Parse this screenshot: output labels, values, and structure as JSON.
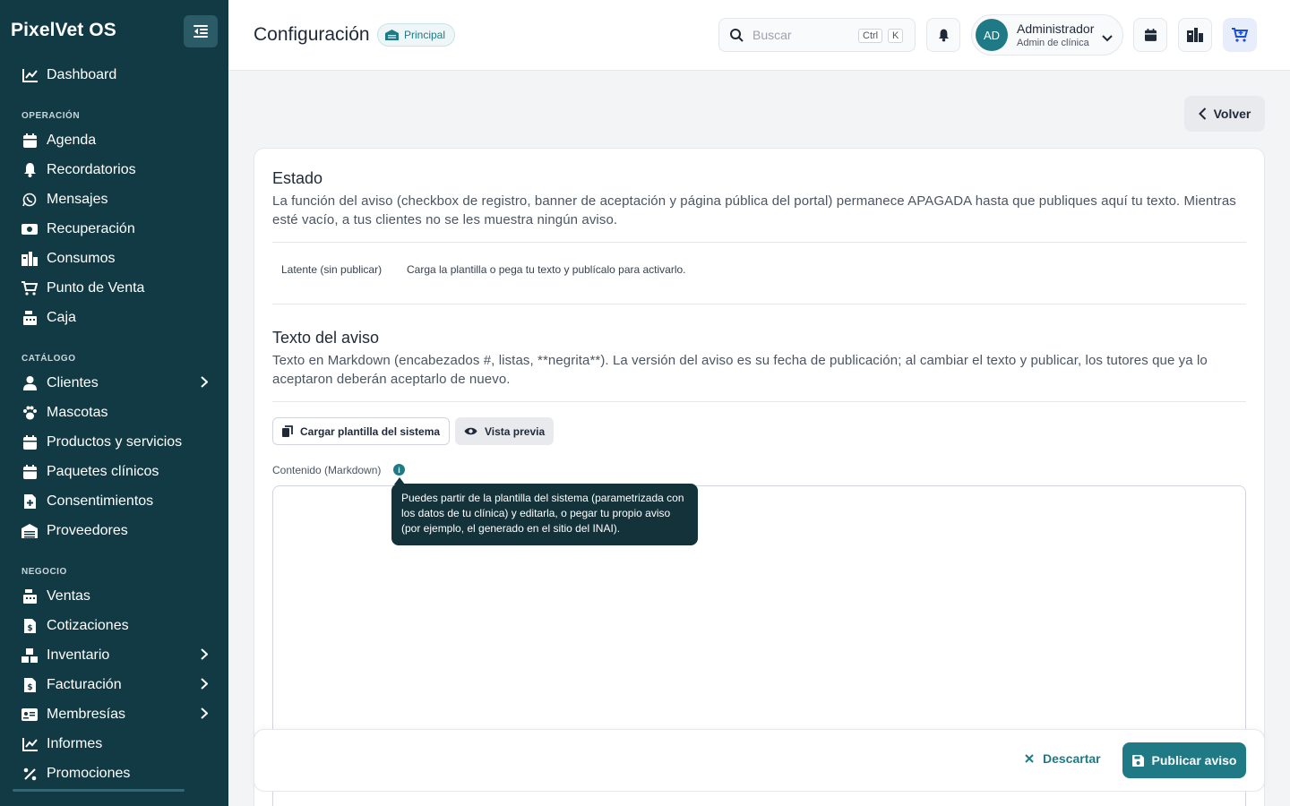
{
  "app": {
    "brand": "PixelVet OS"
  },
  "sidebar": {
    "items": [
      {
        "label": "Dashboard",
        "icon": "chart-line-icon"
      },
      {
        "label": "Agenda",
        "icon": "calendar-icon"
      },
      {
        "label": "Recordatorios",
        "icon": "bell-icon"
      },
      {
        "label": "Mensajes",
        "icon": "whatsapp-icon"
      },
      {
        "label": "Recuperación",
        "icon": "money-icon"
      },
      {
        "label": "Consumos",
        "icon": "consumption-icon"
      },
      {
        "label": "Punto de Venta",
        "icon": "cart-icon"
      },
      {
        "label": "Caja",
        "icon": "cash-register-icon"
      },
      {
        "label": "Clientes",
        "icon": "user-icon"
      },
      {
        "label": "Mascotas",
        "icon": "paw-icon"
      },
      {
        "label": "Productos y servicios",
        "icon": "calendar-icon"
      },
      {
        "label": "Paquetes clínicos",
        "icon": "calendar-icon"
      },
      {
        "label": "Consentimientos",
        "icon": "file-plus-icon"
      },
      {
        "label": "Proveedores",
        "icon": "warehouse-icon"
      },
      {
        "label": "Ventas",
        "icon": "cash-register-icon"
      },
      {
        "label": "Cotizaciones",
        "icon": "invoice-dollar-icon"
      },
      {
        "label": "Inventario",
        "icon": "boxes-icon"
      },
      {
        "label": "Facturación",
        "icon": "invoice-dollar-icon"
      },
      {
        "label": "Membresías",
        "icon": "id-card-icon"
      },
      {
        "label": "Informes",
        "icon": "chart-line-icon"
      },
      {
        "label": "Promociones",
        "icon": "percent-icon"
      }
    ],
    "sections": {
      "operacion": "OPERACIÓN",
      "catalogo": "CATÁLOGO",
      "negocio": "NEGOCIO"
    }
  },
  "header": {
    "title": "Configuración",
    "branch_badge": "Principal",
    "search_placeholder": "Buscar",
    "kbd_ctrl": "Ctrl",
    "kbd_k": "K",
    "user": {
      "initials": "AD",
      "name": "Administrador",
      "role": "Admin de clínica"
    }
  },
  "content": {
    "back_label": "Volver",
    "estado": {
      "title": "Estado",
      "desc": "La función del aviso (checkbox de registro, banner de aceptación y página pública del portal) permanece APAGADA hasta que publiques aquí tu texto. Mientras esté vacío, a tus clientes no se les muestra ningún aviso.",
      "status_label": "Latente (sin publicar)",
      "status_text": "Carga la plantilla o pega tu texto y publícalo para activarlo."
    },
    "texto": {
      "title": "Texto del aviso",
      "desc": "Texto en Markdown (encabezados #, listas, **negrita**). La versión del aviso es su fecha de publicación; al cambiar el texto y publicar, los tutores que ya lo aceptaron deberán aceptarlo de nuevo.",
      "load_template": "Cargar plantilla del sistema",
      "preview": "Vista previa",
      "field_label": "Contenido (Markdown)",
      "tooltip": "Puedes partir de la plantilla del sistema (parametrizada con los datos de tu clínica) y editarla, o pegar tu propio aviso (por ejemplo, el generado en el sitio del INAI)."
    },
    "footer": {
      "discard": "Descartar",
      "publish": "Publicar aviso"
    }
  },
  "colors": {
    "sidebar_bg": "#123a44",
    "accent": "#1f7a86",
    "tooltip_bg": "#14323a"
  }
}
